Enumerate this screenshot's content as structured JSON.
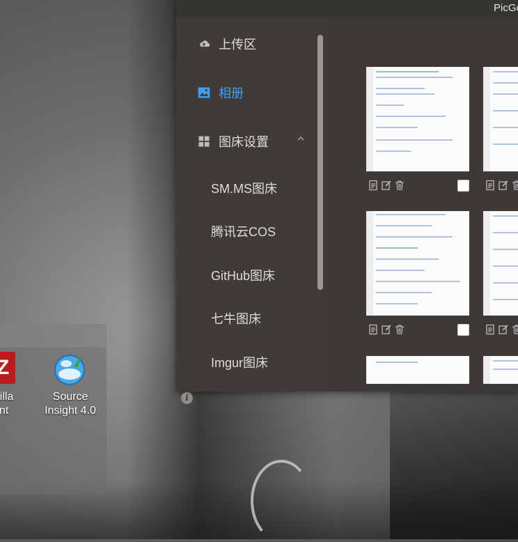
{
  "app": {
    "title": "PicGo"
  },
  "sidebar": {
    "items": [
      {
        "label": "上传区",
        "icon": "cloud-upload-icon"
      },
      {
        "label": "相册",
        "icon": "image-icon",
        "active": true
      },
      {
        "label": "图床设置",
        "icon": "grid-icon"
      }
    ],
    "sub_items": [
      "SM.MS图床",
      "腾讯云COS",
      "GitHub图床",
      "七牛图床",
      "Imgur图床"
    ],
    "info_icon": "i"
  },
  "desktop": {
    "icons": [
      {
        "name": "FileZilla Client",
        "line1": "Zilla",
        "line2": "ent"
      },
      {
        "name": "Source Insight 4.0",
        "line1": "Source",
        "line2": "Insight 4.0"
      }
    ],
    "filezilla_glyph": "Z"
  },
  "colors": {
    "accent": "#409eff",
    "window_bg": "#3c3937",
    "sidebar_bg": "#3f3b37"
  }
}
